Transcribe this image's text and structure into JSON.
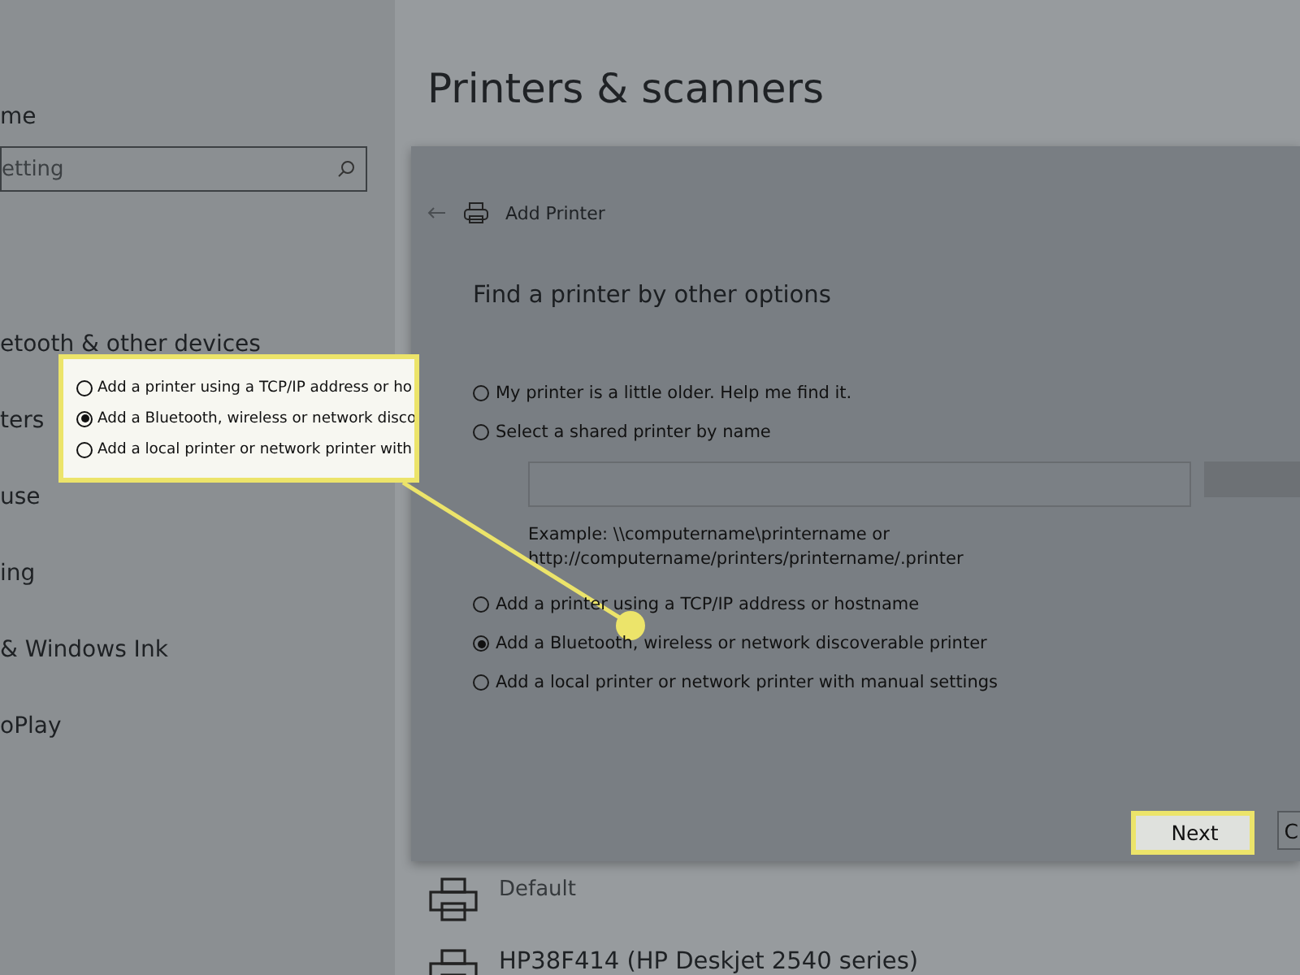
{
  "sidebar": {
    "top_item": "me",
    "search": {
      "value": "etting"
    },
    "items": [
      {
        "label": "etooth & other devices"
      },
      {
        "label": "ters"
      },
      {
        "label": "use"
      },
      {
        "label": "ing"
      },
      {
        "label": "& Windows Ink"
      },
      {
        "label": "oPlay"
      }
    ]
  },
  "page_title": "Printers & scanners",
  "dialog": {
    "title": "Add Printer",
    "heading": "Find a printer by other options",
    "options_top": [
      {
        "label": "My printer is a little older. Help me find it.",
        "selected": false
      },
      {
        "label": "Select a shared printer by name",
        "selected": false
      }
    ],
    "example": "Example: \\\\computername\\printername or\nhttp://computername/printers/printername/.printer",
    "options_bottom": [
      {
        "label": "Add a printer using a TCP/IP address or hostname",
        "selected": false
      },
      {
        "label": "Add a Bluetooth, wireless or network discoverable printer",
        "selected": true
      },
      {
        "label": "Add a local printer or network printer with manual settings",
        "selected": false
      }
    ],
    "buttons": [
      "Next",
      "C"
    ]
  },
  "printers": [
    {
      "status": "Default"
    },
    {
      "name": "HP38F414 (HP Deskjet 2540 series)"
    }
  ],
  "callout": {
    "options": [
      {
        "label": "Add a printer using a TCP/IP address or ho",
        "selected": false
      },
      {
        "label": "Add a Bluetooth, wireless or network disco",
        "selected": true
      },
      {
        "label": "Add a local printer or network printer with",
        "selected": false
      }
    ]
  }
}
